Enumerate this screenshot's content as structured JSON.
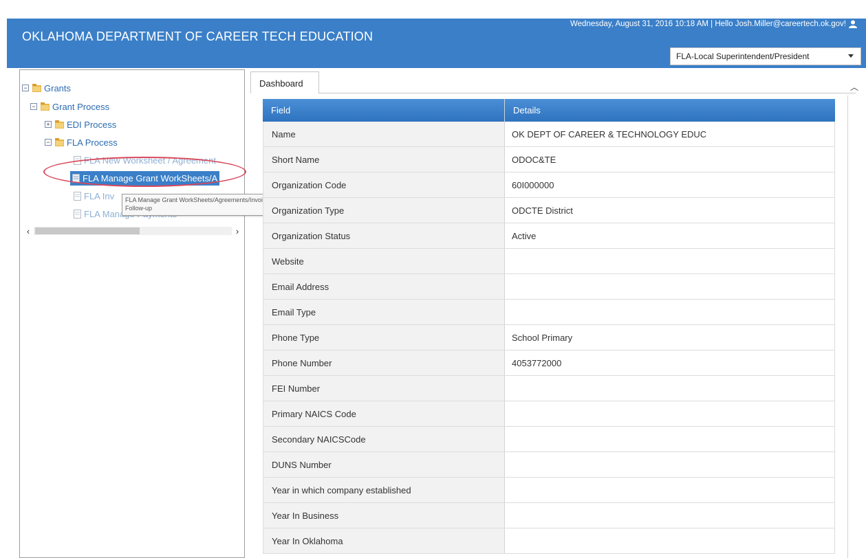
{
  "header": {
    "title": "OKLAHOMA DEPARTMENT OF CAREER TECH EDUCATION",
    "user_info": "Wednesday, August 31, 2016 10:18 AM | Hello Josh.Miller@careertech.ok.gov!",
    "user_icon": "user-icon",
    "role": "FLA-Local Superintendent/President"
  },
  "tree": {
    "root": "Grants",
    "grant_process": "Grant Process",
    "edi_process": "EDI Process",
    "fla_process": "FLA Process",
    "fla_new": "FLA New Worksheet / Agreement",
    "fla_manage": "FLA Manage Grant WorkSheets/A",
    "fla_inv": "FLA Inv",
    "fla_payments": "FLA Manage Payments",
    "tooltip_line1": "FLA Manage Grant WorkSheets/Agreements/Invoice/",
    "tooltip_line2": "Follow-up"
  },
  "tabs": {
    "dashboard": "Dashboard"
  },
  "grid": {
    "headers": [
      "Field",
      "Details"
    ],
    "rows": [
      {
        "field": "Name",
        "details": "OK DEPT OF CAREER & TECHNOLOGY EDUC"
      },
      {
        "field": "Short Name",
        "details": "ODOC&TE"
      },
      {
        "field": "Organization Code",
        "details": "60I000000"
      },
      {
        "field": "Organization Type",
        "details": "ODCTE District"
      },
      {
        "field": "Organization Status",
        "details": "Active"
      },
      {
        "field": "Website",
        "details": ""
      },
      {
        "field": "Email Address",
        "details": ""
      },
      {
        "field": "Email Type",
        "details": ""
      },
      {
        "field": "Phone Type",
        "details": "School Primary"
      },
      {
        "field": "Phone Number",
        "details": "4053772000"
      },
      {
        "field": "FEI Number",
        "details": ""
      },
      {
        "field": "Primary NAICS Code",
        "details": ""
      },
      {
        "field": "Secondary NAICSCode",
        "details": ""
      },
      {
        "field": "DUNS Number",
        "details": ""
      },
      {
        "field": "Year in which company established",
        "details": ""
      },
      {
        "field": "Year In Business",
        "details": ""
      },
      {
        "field": "Year In Oklahoma",
        "details": ""
      }
    ]
  }
}
